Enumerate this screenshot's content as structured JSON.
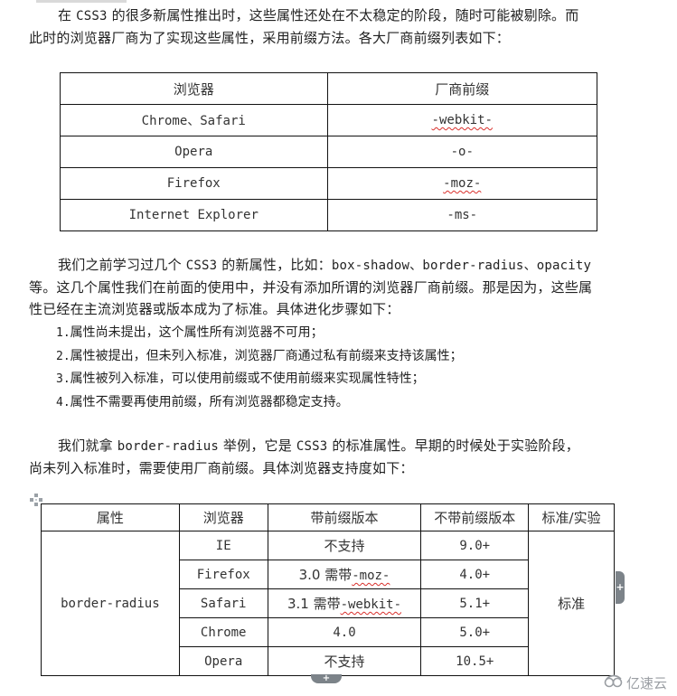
{
  "intro_paragraph": {
    "line1_lead": "在 ",
    "line1_code": "CSS3",
    "line1_rest": " 的很多新属性推出时，这些属性还处在不太稳定的阶段，随时可能被剔除。而",
    "line2": "此时的浏览器厂商为了实现这些属性，采用前缀方法。各大厂商前缀列表如下："
  },
  "prefix_table": {
    "headers": [
      "浏览器",
      "厂商前缀"
    ],
    "rows": [
      {
        "browser": "Chrome、Safari",
        "prefix": "-webkit-",
        "spell_flag": true
      },
      {
        "browser": "Opera",
        "prefix": "-o-",
        "spell_flag": false
      },
      {
        "browser": "Firefox",
        "prefix": "-moz-",
        "spell_flag": true
      },
      {
        "browser": "Internet Explorer",
        "prefix": "-ms-",
        "spell_flag": false
      }
    ]
  },
  "history_paragraph": {
    "line1_lead": "我们之前学习过几个 ",
    "line1_code1": "CSS3",
    "line1_mid": " 的新属性，比如：",
    "line1_code2": "box-shadow、border-radius、opacity",
    "line2": "等。这几个属性我们在前面的使用中，并没有添加所谓的浏览器厂商前缀。那是因为，这些属",
    "line3": "性已经在主流浏览器或版本成为了标准。具体进化步骤如下："
  },
  "steps": [
    {
      "num": "1.",
      "text": "属性尚未提出，这个属性所有浏览器不可用；"
    },
    {
      "num": "2.",
      "text": "属性被提出，但未列入标准，浏览器厂商通过私有前缀来支持该属性；"
    },
    {
      "num": "3.",
      "text": "属性被列入标准，可以使用前缀或不使用前缀来实现属性特性；"
    },
    {
      "num": "4.",
      "text": "属性不需要再使用前缀，所有浏览器都稳定支持。"
    }
  ],
  "example_paragraph": {
    "line1_lead": "我们就拿 ",
    "line1_code1": "border-radius",
    "line1_mid": " 举例，它是 ",
    "line1_code2": "CSS3",
    "line1_rest": " 的标准属性。早期的时候处于实验阶段，",
    "line2": "尚未列入标准时，需要使用厂商前缀。具体浏览器支持度如下："
  },
  "support_table": {
    "headers": [
      "属性",
      "浏览器",
      "带前缀版本",
      "不带前缀版本",
      "标准/实验"
    ],
    "property": "border-radius",
    "status": "标准",
    "rows": [
      {
        "browser": "IE",
        "prefixed": "不支持",
        "prefixed_code": "",
        "unprefixed": "9.0+"
      },
      {
        "browser": "Firefox",
        "prefixed": "3.0 需带",
        "prefixed_code": "-moz-",
        "unprefixed": "4.0+"
      },
      {
        "browser": "Safari",
        "prefixed": "3.1 需带",
        "prefixed_code": "-webkit-",
        "unprefixed": "5.1+"
      },
      {
        "browser": "Chrome",
        "prefixed": "4.0",
        "prefixed_code": "",
        "unprefixed": "5.0+"
      },
      {
        "browser": "Opera",
        "prefixed": "不支持",
        "prefixed_code": "",
        "unprefixed": "10.5+"
      }
    ]
  },
  "editor_controls": {
    "move_handle_icon": "move-arrows-icon",
    "add_column_label": "+",
    "add_row_label": "+"
  },
  "watermark": {
    "logo_icon": "cloud-logo-icon",
    "text": "亿速云"
  }
}
